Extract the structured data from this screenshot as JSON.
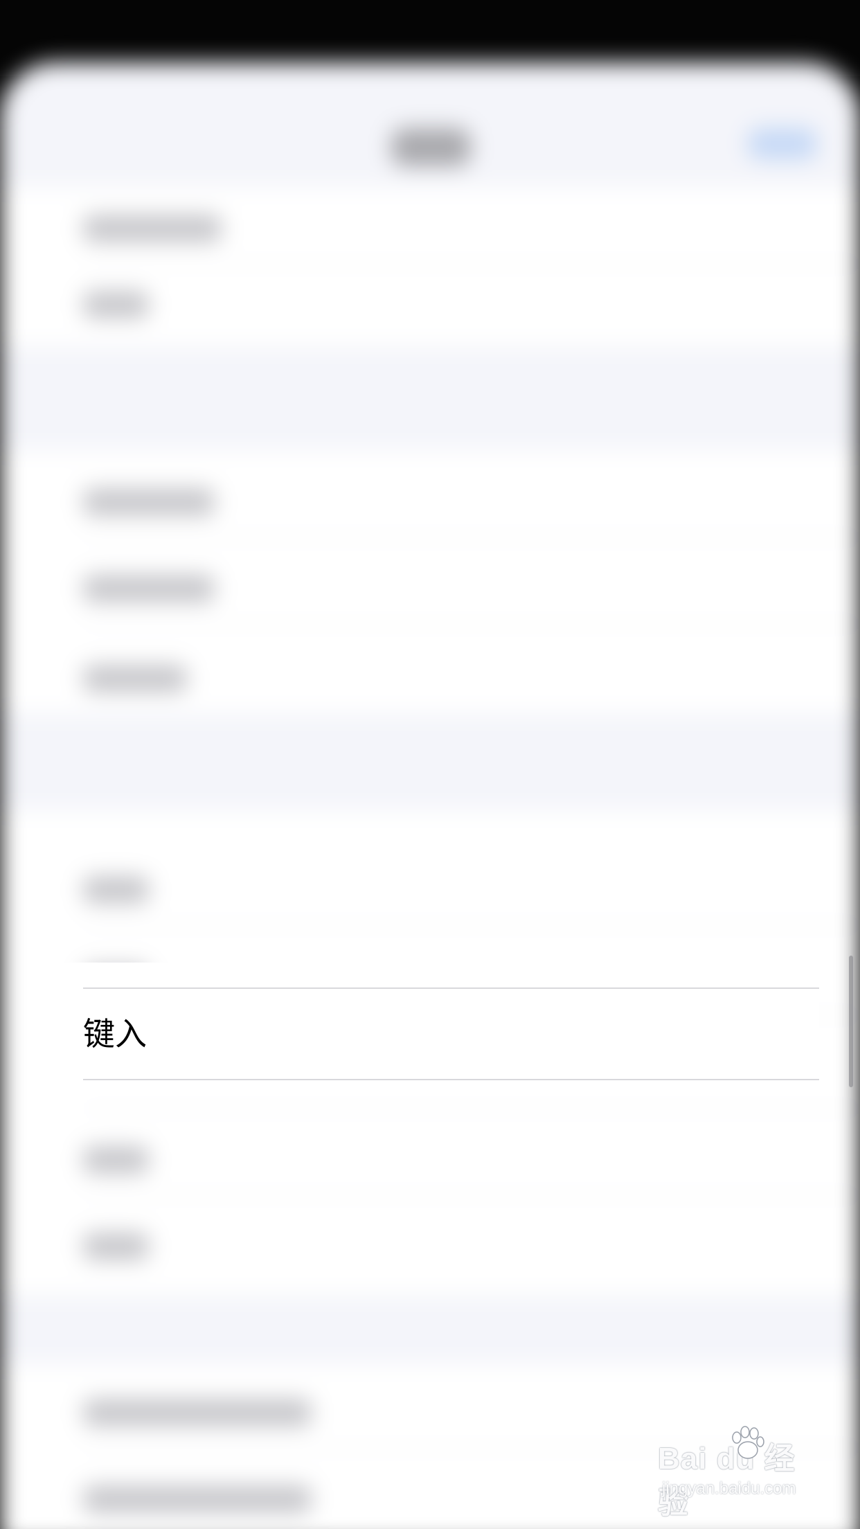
{
  "focused_row": {
    "label": "键入"
  },
  "watermark": {
    "logo_text": "Bai du 经验",
    "sub_text": "jingyan.baidu.com"
  },
  "colors": {
    "sheet_background": "#f4f5fa",
    "row_background": "#ffffff",
    "accent_blue": "#c6d9f6",
    "text_primary": "#000000"
  }
}
